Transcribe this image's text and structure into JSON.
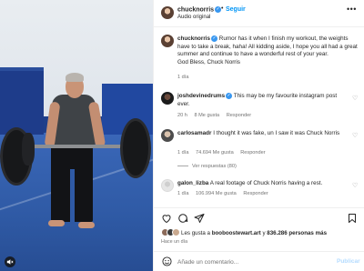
{
  "post": {
    "author": "chucknorris",
    "follow_label": "Seguir",
    "dot": "•",
    "audio": "Audio original",
    "more": "•••",
    "caption": {
      "username": "chucknorris",
      "text": "Rumor has it when I finish my workout, the weights have to take a break, haha! All kidding aside, I hope you all had a great summer and continue to have a wonderful rest of your year.",
      "signoff": "God Bless, Chuck Norris",
      "time": "1 día"
    }
  },
  "comments": [
    {
      "username": "joshdevinedrums",
      "verified": true,
      "text": "This may be my favourite instagram post ever.",
      "time": "20 h",
      "likes": "8 Me gusta",
      "reply_label": "Responder"
    },
    {
      "username": "carlosamadr",
      "verified": false,
      "text": "I thought it was fake, un I saw it was Chuck Norris",
      "time": "1 día",
      "likes": "74.694 Me gusta",
      "reply_label": "Responder",
      "view_replies": "Ver respuestas (80)"
    },
    {
      "username": "galon_lizba",
      "verified": false,
      "text": "A real footage of Chuck Norris having a rest.",
      "time": "1 día",
      "likes": "106.994 Me gusta",
      "reply_label": "Responder"
    }
  ],
  "engagement": {
    "liked_prefix": "Les gusta a",
    "liked_user": "booboostewart.art",
    "liked_suffix": "y",
    "liked_count": "836.286 personas",
    "liked_more": "más",
    "time": "Hace un día"
  },
  "composer": {
    "placeholder": "Añade un comentario...",
    "post_label": "Publicar"
  },
  "icons": {
    "heart": "heart-icon",
    "comment": "comment-icon",
    "share": "share-icon",
    "save": "bookmark-icon",
    "emoji": "emoji-icon",
    "mute": "speaker-muted-icon",
    "verified": "verified-badge-icon"
  },
  "colors": {
    "accent": "#0095f6",
    "verified": "#3897f0",
    "muted_text": "#737373",
    "post_disabled": "#b3dbff"
  }
}
